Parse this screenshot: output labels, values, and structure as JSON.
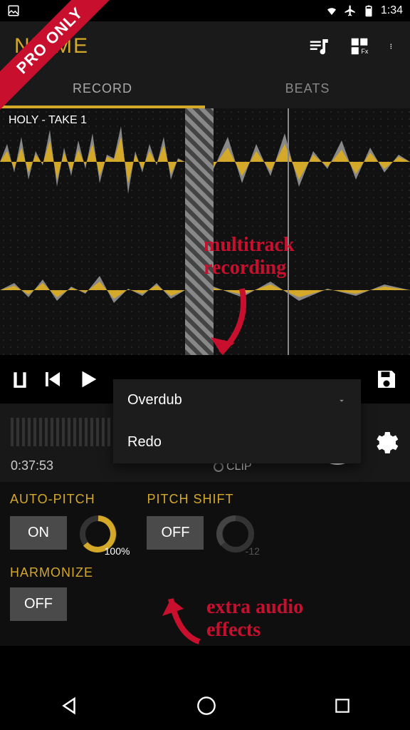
{
  "status": {
    "time": "1:34"
  },
  "proRibbon": "PRO ONLY",
  "header": {
    "title": "NE ME"
  },
  "tabs": {
    "record": "RECORD",
    "beats": "BEATS"
  },
  "track": {
    "label": "HOLY - TAKE 1"
  },
  "dropdown": {
    "selected": "Overdub",
    "items": [
      "Overdub",
      "Redo"
    ]
  },
  "recBar": {
    "time": "0:37:53",
    "clip": "CLIP"
  },
  "effects": {
    "autoPitch": {
      "label": "AUTO-PITCH",
      "state": "ON",
      "knob": "100%"
    },
    "pitchShift": {
      "label": "PITCH SHIFT",
      "state": "OFF",
      "knob": "-12"
    },
    "harmonize": {
      "label": "HARMONIZE",
      "state": "OFF"
    }
  },
  "annotations": {
    "multitrack": "multitrack recording",
    "extra": "extra audio effects"
  }
}
